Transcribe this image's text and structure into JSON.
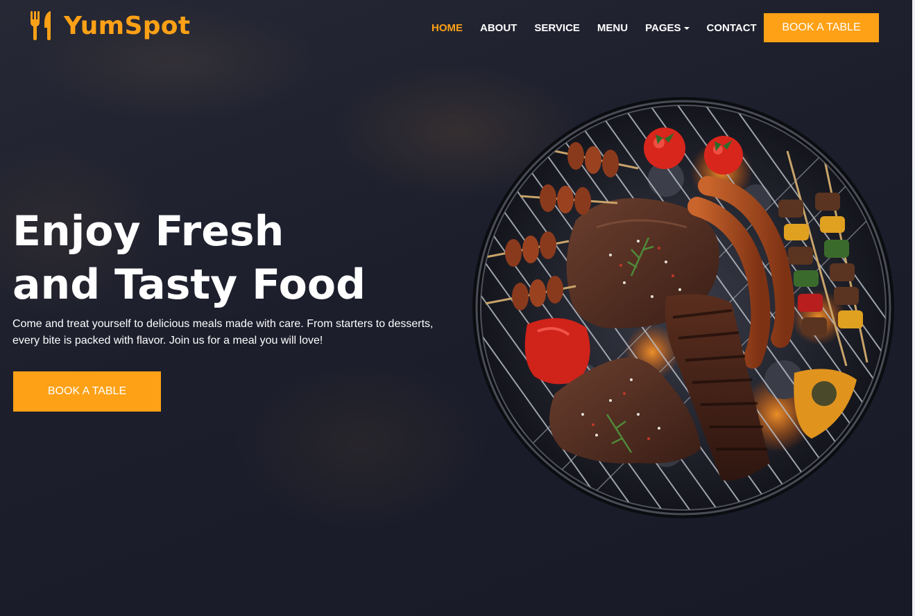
{
  "brand": {
    "name": "YumSpot",
    "icon": "utensils-icon",
    "color": "#fea116"
  },
  "nav": {
    "items": [
      {
        "label": "HOME",
        "active": true
      },
      {
        "label": "ABOUT"
      },
      {
        "label": "SERVICE"
      },
      {
        "label": "MENU"
      },
      {
        "label": "PAGES",
        "dropdown": true
      },
      {
        "label": "CONTACT"
      }
    ],
    "cta_label": "BOOK A TABLE"
  },
  "hero": {
    "title_line1": "Enjoy Fresh",
    "title_line2": "and Tasty Food",
    "text_line1": "Come and treat yourself to delicious meals made with care. From starters to desserts,",
    "text_line2": "every bite is packed with flavor. Join us for a meal you will love!",
    "cta_label": "BOOK A TABLE",
    "image": "barbecue-grill-image"
  },
  "colors": {
    "accent": "#fea116",
    "background": "#1b1d2c",
    "text": "#ffffff"
  }
}
